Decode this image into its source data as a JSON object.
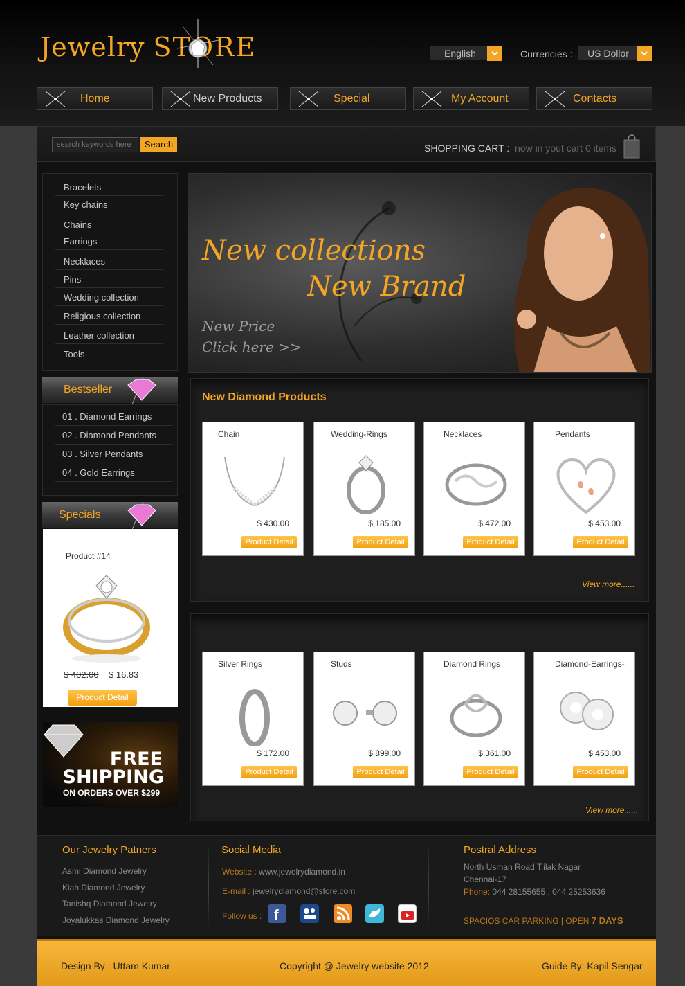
{
  "logo": {
    "text_main": "Jewelry",
    "text_store": "STORE"
  },
  "language": {
    "selected": "English"
  },
  "currency": {
    "label": "Currencies :",
    "selected": "US Dollor"
  },
  "nav": [
    {
      "label": "Home",
      "color": "#f3a623"
    },
    {
      "label": "New Products",
      "color": "#cccccc"
    },
    {
      "label": "Special",
      "color": "#f3a623"
    },
    {
      "label": "My Account",
      "color": "#f3a623"
    },
    {
      "label": "Contacts",
      "color": "#f3a623"
    }
  ],
  "search": {
    "placeholder": "search keywords here",
    "button": "Search"
  },
  "cart": {
    "label": "SHOPPING CART :",
    "status": "now in yout cart 0 items"
  },
  "categories": [
    "Bracelets",
    "Key chains",
    "Chains",
    "Earrings",
    "Necklaces",
    "Pins",
    "Wedding collection",
    "Religious collection",
    "Leather collection",
    "Tools"
  ],
  "bestseller": {
    "title": "Bestseller",
    "items": [
      "01 . Diamond Earrings",
      "02 . Diamond Pendants",
      "03 . Silver Pendants",
      "04 . Gold Earrings"
    ]
  },
  "specials": {
    "title": "Specials",
    "product": "Product #14",
    "old_price": "$ 402.00",
    "new_price": "$ 16.83",
    "button": "Product Detail"
  },
  "shipping": {
    "line1": "FREE",
    "line2": "SHIPPING",
    "line3": "ON ORDERS OVER $299"
  },
  "banner": {
    "headline1": "New collections",
    "headline2": "New Brand",
    "price": "New Price",
    "cta": "Click here >>"
  },
  "new_products": {
    "title": "New Diamond Products",
    "view_more": "View more......",
    "items": [
      {
        "name": "Chain",
        "price": "$ 430.00",
        "button": "Product Detail",
        "icon": "chain-necklace-icon"
      },
      {
        "name": "Wedding-Rings",
        "price": "$ 185.00",
        "button": "Product Detail",
        "icon": "wedding-ring-icon"
      },
      {
        "name": "Necklaces",
        "price": "$ 472.00",
        "button": "Product Detail",
        "icon": "infinity-ring-icon"
      },
      {
        "name": "Pendants",
        "price": "$ 453.00",
        "button": "Product Detail",
        "icon": "heart-pendant-icon"
      }
    ]
  },
  "more_products": {
    "view_more": "View more......",
    "items": [
      {
        "name": "Silver Rings",
        "price": "$ 172.00",
        "button": "Product Detail",
        "icon": "silver-ring-icon"
      },
      {
        "name": "Studs",
        "price": "$ 899.00",
        "button": "Product Detail",
        "icon": "stud-earrings-icon"
      },
      {
        "name": "Diamond Rings",
        "price": "$ 361.00",
        "button": "Product Detail",
        "icon": "diamond-ring-icon"
      },
      {
        "name": "Diamond-Earrings-",
        "price": "$ 453.00",
        "button": "Product Detail",
        "icon": "diamond-earrings-icon"
      }
    ]
  },
  "footer": {
    "partners": {
      "title": "Our Jewelry Patners",
      "items": [
        "Asmi Diamond Jewelry",
        "Kiah Diamond Jewelry",
        "Tanishq Diamond Jewelry",
        "Joyalukkas Diamond Jewelry"
      ]
    },
    "social": {
      "title": "Social Media",
      "website_label": "Website :",
      "website": "www.jewelrydiamond.in",
      "email_label": "E-mail :",
      "email": "jewelrydiamond@store.com",
      "follow": "Follow us :",
      "icons": [
        "facebook-icon",
        "myspace-icon",
        "rss-icon",
        "twitter-icon",
        "youtube-icon"
      ]
    },
    "address": {
      "title": "Postral Address",
      "line1": "North Usman Road T.ilak Nagar",
      "line2": "Chennai-17",
      "phone_label": "Phone:",
      "phone": "044 28155655 , 044 25253636",
      "parking": "SPACIOS CAR PARKING | OPEN",
      "days": "7 DAYS"
    }
  },
  "bottom": {
    "design": "Design By : Uttam Kumar",
    "copyright": "Copyright @ Jewelry website 2012",
    "guide": "Guide By: Kapil Sengar"
  },
  "colors": {
    "accent": "#f3a623",
    "background": "#3a3a3a"
  }
}
